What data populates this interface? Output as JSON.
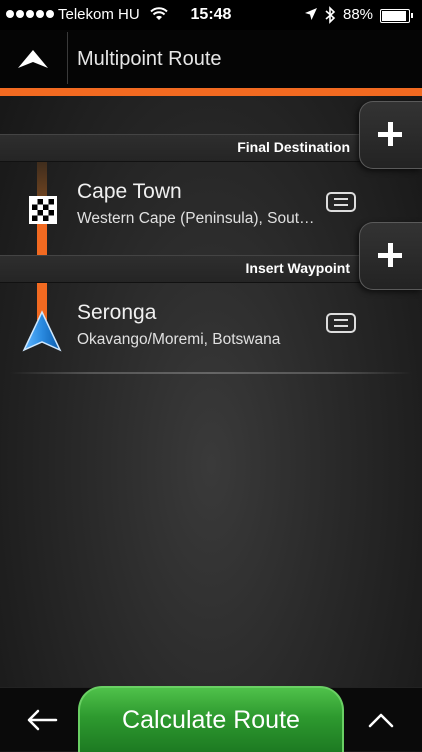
{
  "status_bar": {
    "carrier": "Telekom HU",
    "time": "15:48",
    "battery": "88%"
  },
  "header": {
    "title": "Multipoint Route"
  },
  "final_destination": {
    "label": "Final Destination"
  },
  "destination": {
    "name": "Cape Town",
    "detail": "Western Cape (Peninsula), South Africa"
  },
  "insert_waypoint": {
    "label": "Insert Waypoint"
  },
  "origin": {
    "name": "Seronga",
    "detail": "Okavango/Moremi, Botswana"
  },
  "bottom_bar": {
    "calculate_label": "Calculate Route"
  },
  "colors": {
    "accent": "#f26a21",
    "button_green": "#2e9a2f",
    "nav_arrow_blue": "#1e88e5"
  }
}
